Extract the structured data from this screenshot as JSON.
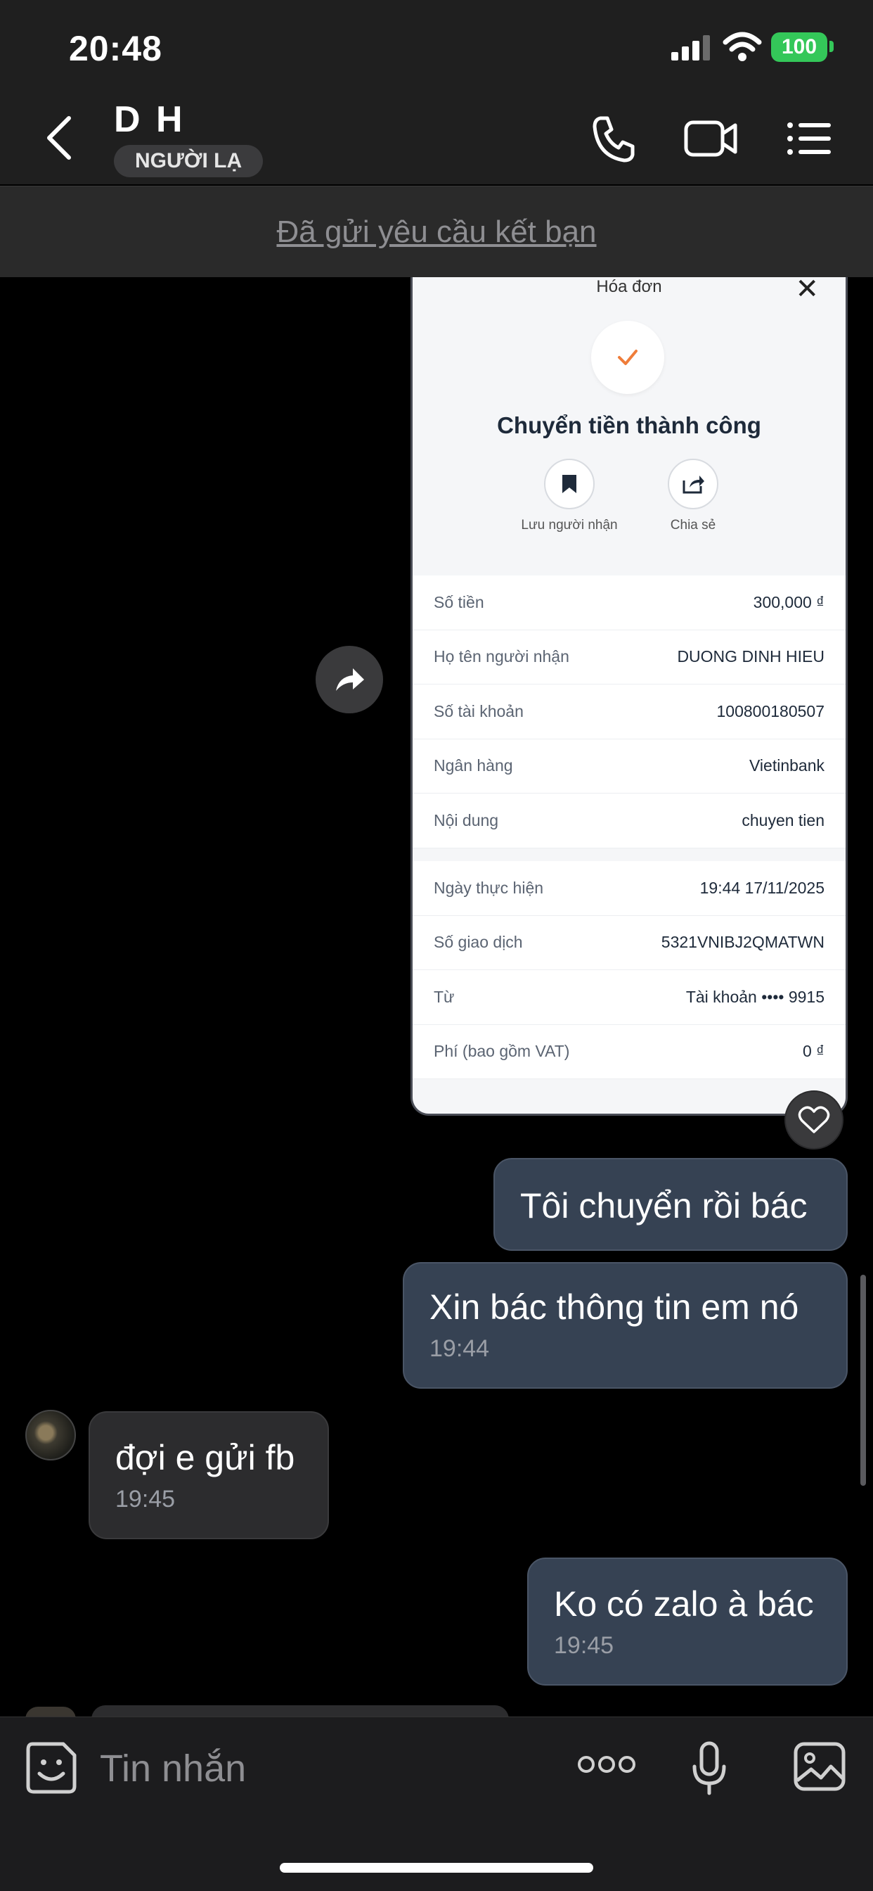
{
  "status_bar": {
    "time": "20:48",
    "battery": "100"
  },
  "header": {
    "contact_name": "D H",
    "badge": "NGƯỜI LẠ",
    "icons": [
      "back-arrow-icon",
      "phone-icon",
      "video-call-icon",
      "menu-list-icon"
    ]
  },
  "friend_request": {
    "text": "Đã gửi yêu cầu kết bạn"
  },
  "receipt": {
    "title": "Hóa đơn",
    "close": "✕",
    "headline": "Chuyển tiền thành công",
    "actions": [
      {
        "label": "Lưu người nhận",
        "icon": "bookmark-icon"
      },
      {
        "label": "Chia sẻ",
        "icon": "share-icon"
      }
    ],
    "rows_top": [
      {
        "key": "Số tiền",
        "value": "300,000 ₫"
      },
      {
        "key": "Họ tên người nhận",
        "value": "DUONG DINH HIEU"
      },
      {
        "key": "Số tài khoản",
        "value": "100800180507"
      },
      {
        "key": "Ngân hàng",
        "value": "Vietinbank"
      },
      {
        "key": "Nội dung",
        "value": "chuyen tien"
      }
    ],
    "rows_bottom": [
      {
        "key": "Ngày thực hiện",
        "value": "19:44 17/11/2025"
      },
      {
        "key": "Số giao dịch",
        "value": "5321VNIBJ2QMATWN"
      },
      {
        "key": "Từ",
        "value": "Tài khoản •••• 9915"
      },
      {
        "key": "Phí (bao gồm VAT)",
        "value": "0 ₫"
      }
    ]
  },
  "messages": [
    {
      "direction": "out",
      "text": "Tôi chuyển rồi bác"
    },
    {
      "direction": "out",
      "text": "Xin bác thông tin em nó",
      "time": "19:44"
    },
    {
      "direction": "in",
      "text": "đợi e gửi fb",
      "time": "19:45"
    },
    {
      "direction": "out",
      "text": "Ko có zalo à bác",
      "time": "19:45"
    }
  ],
  "composer": {
    "placeholder": "Tin nhắn",
    "icons": [
      "sticker-icon",
      "more-options-icon",
      "microphone-icon",
      "image-icon"
    ]
  },
  "colors": {
    "outgoing_bubble": "#364253",
    "incoming_bubble": "#2c2c2e",
    "battery": "#34c759",
    "check_accent": "#ef7d3a"
  }
}
